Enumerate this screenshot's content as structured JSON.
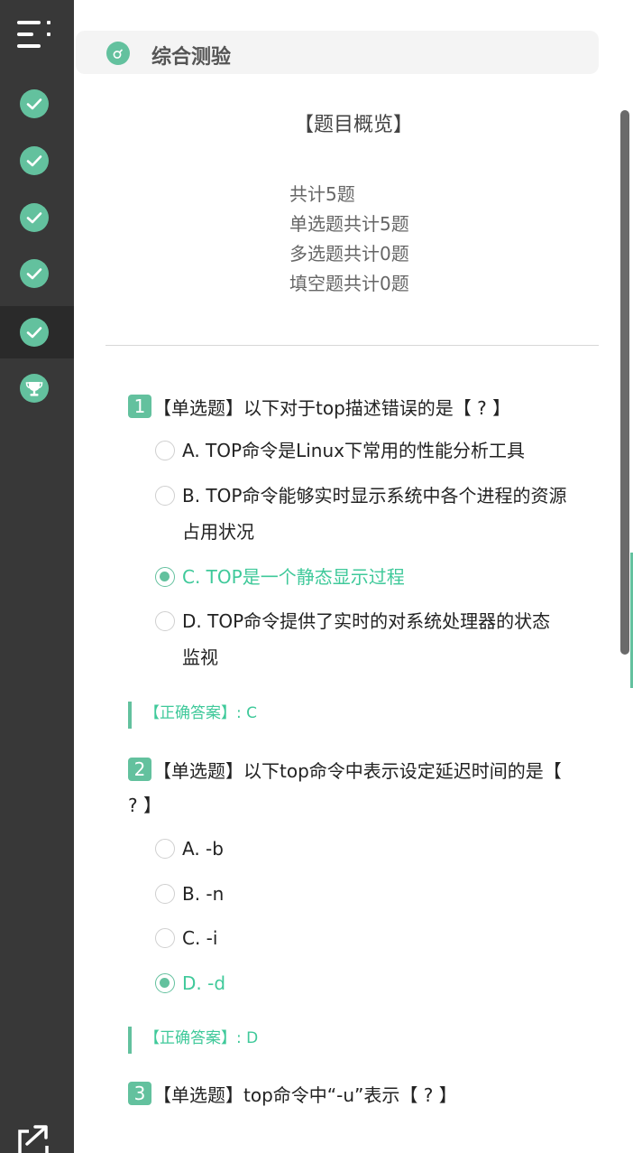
{
  "section": {
    "title": "综合测验"
  },
  "overview": {
    "title": "【题目概览】",
    "lines": [
      "共计5题",
      "单选题共计5题",
      "多选题共计0题",
      "填空题共计0题"
    ]
  },
  "questions": [
    {
      "num": "1",
      "title": "【单选题】以下对于top描述错误的是【 ? 】",
      "options": [
        "A. TOP命令是Linux下常用的性能分析工具",
        "B. TOP命令能够实时显示系统中各个进程的资源占用状况",
        "C. TOP是一个静态显示过程",
        "D. TOP命令提供了实时的对系统处理器的状态监视"
      ],
      "selected": "C",
      "answer_label": "【正确答案】: C"
    },
    {
      "num": "2",
      "title": "【单选题】以下top命令中表示设定延迟时间的是【 ? 】",
      "options": [
        "A. -b",
        "B. -n",
        "C. -i",
        "D. -d"
      ],
      "selected": "D",
      "answer_label": "【正确答案】: D"
    },
    {
      "num": "3",
      "title": "【单选题】top命令中“-u”表示【 ? 】"
    }
  ],
  "colors": {
    "accent": "#63c19e",
    "sidebar": "#383838",
    "correct_text": "#3fc99a",
    "check": "#3dd47a"
  },
  "icons": {
    "menu": "menu-icon",
    "nav": [
      "check-icon",
      "check-icon",
      "check-icon",
      "check-icon",
      "check-icon",
      "trophy-icon"
    ],
    "export": "export-icon"
  }
}
